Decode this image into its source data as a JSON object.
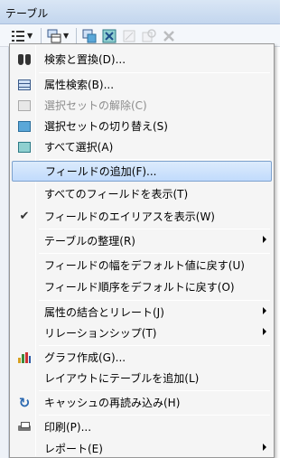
{
  "window": {
    "title": "テーブル"
  },
  "toolbar": {
    "buttons": [
      "table-options",
      "related-tables",
      "select-by-attributes",
      "switch-selection",
      "clear-selection",
      "zoom-to-selected",
      "delete-selected"
    ]
  },
  "menu": {
    "items": [
      {
        "label": "検索と置換(D)...",
        "icon": "binoculars-icon",
        "enabled": true,
        "submenu": false
      },
      {
        "label": "属性検索(B)...",
        "icon": "select-by-attributes-icon",
        "enabled": true,
        "submenu": false
      },
      {
        "label": "選択セットの解除(C)",
        "icon": "clear-selection-icon",
        "enabled": false,
        "submenu": false
      },
      {
        "label": "選択セットの切り替え(S)",
        "icon": "switch-selection-icon",
        "enabled": true,
        "submenu": false
      },
      {
        "label": "すべて選択(A)",
        "icon": "select-all-icon",
        "enabled": true,
        "submenu": false
      },
      {
        "label": "フィールドの追加(F)...",
        "icon": "",
        "enabled": true,
        "submenu": false,
        "highlighted": true
      },
      {
        "label": "すべてのフィールドを表示(T)",
        "icon": "",
        "enabled": true,
        "submenu": false
      },
      {
        "label": "フィールドのエイリアスを表示(W)",
        "icon": "checkmark-icon",
        "enabled": true,
        "submenu": false
      },
      {
        "label": "テーブルの整理(R)",
        "icon": "",
        "enabled": true,
        "submenu": true
      },
      {
        "label": "フィールドの幅をデフォルト値に戻す(U)",
        "icon": "",
        "enabled": true,
        "submenu": false
      },
      {
        "label": "フィールド順序をデフォルトに戻す(O)",
        "icon": "",
        "enabled": true,
        "submenu": false
      },
      {
        "label": "属性の結合とリレート(J)",
        "icon": "",
        "enabled": true,
        "submenu": true
      },
      {
        "label": "リレーションシップ(T)",
        "icon": "",
        "enabled": true,
        "submenu": true
      },
      {
        "label": "グラフ作成(G)...",
        "icon": "bar-chart-icon",
        "enabled": true,
        "submenu": false
      },
      {
        "label": "レイアウトにテーブルを追加(L)",
        "icon": "",
        "enabled": true,
        "submenu": false
      },
      {
        "label": "キャッシュの再読み込み(H)",
        "icon": "refresh-icon",
        "enabled": true,
        "submenu": false
      },
      {
        "label": "印刷(P)...",
        "icon": "printer-icon",
        "enabled": true,
        "submenu": false
      },
      {
        "label": "レポート(E)",
        "icon": "",
        "enabled": true,
        "submenu": true
      }
    ]
  }
}
